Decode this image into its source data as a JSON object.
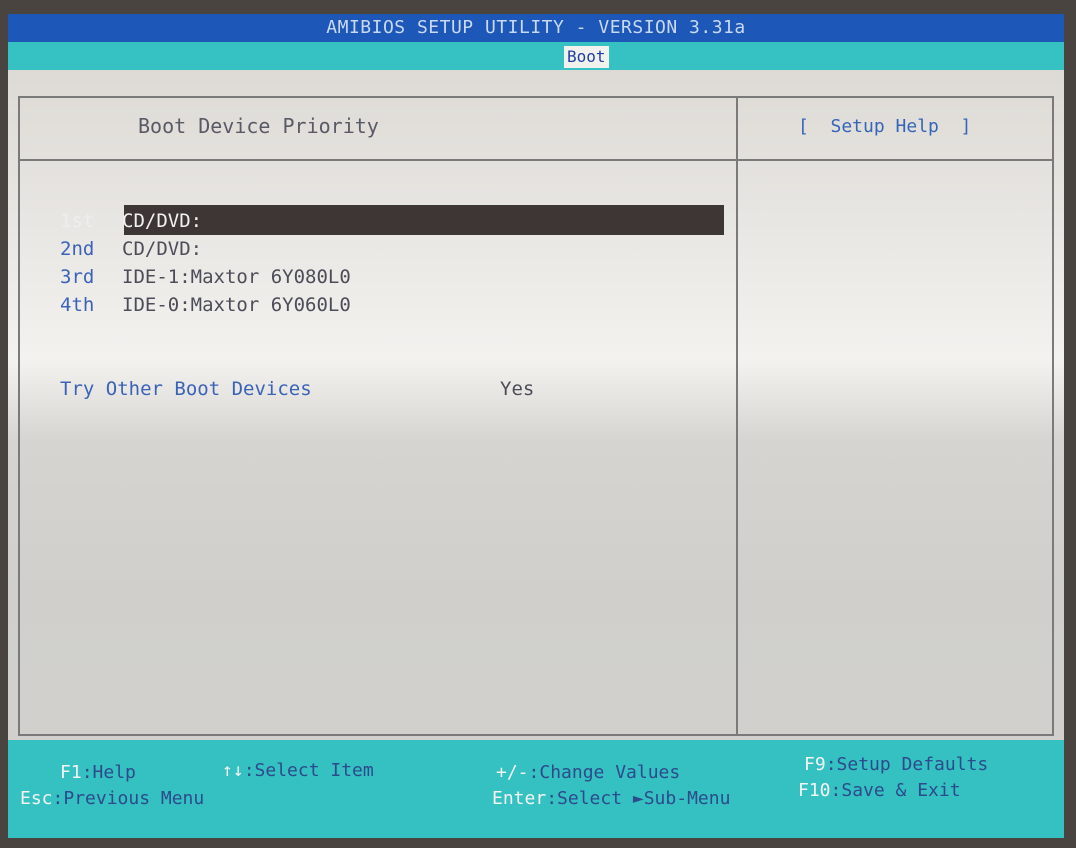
{
  "title": "AMIBIOS SETUP UTILITY - VERSION 3.31a",
  "menu": {
    "active_tab": "Boot"
  },
  "panel": {
    "title": "Boot Device Priority"
  },
  "help": {
    "title": "[  Setup Help  ]"
  },
  "boot_order": [
    {
      "ordinal": "1st",
      "device": "CD/DVD:",
      "selected": true
    },
    {
      "ordinal": "2nd",
      "device": "CD/DVD:",
      "selected": false
    },
    {
      "ordinal": "3rd",
      "device": "IDE-1:Maxtor 6Y080L0",
      "selected": false
    },
    {
      "ordinal": "4th",
      "device": "IDE-0:Maxtor 6Y060L0",
      "selected": false
    }
  ],
  "option": {
    "label": "Try Other Boot Devices",
    "value": "Yes"
  },
  "footer": {
    "keys": [
      {
        "key": "F1",
        "desc": ":Help"
      },
      {
        "key": "↑↓",
        "desc": ":Select Item"
      },
      {
        "key": "Esc",
        "desc": ":Previous Menu"
      },
      {
        "key": "+/-",
        "desc": ":Change Values"
      },
      {
        "key": "Enter",
        "desc": ":Select ►Sub-Menu"
      },
      {
        "key": "F9",
        "desc": ":Setup Defaults"
      },
      {
        "key": "F10",
        "desc": ":Save & Exit"
      }
    ]
  },
  "colors": {
    "title_bar": "#1d57b8",
    "menu_bar": "#36c2c2",
    "highlight": "#3d3634",
    "label_blue": "#3a63b8"
  }
}
